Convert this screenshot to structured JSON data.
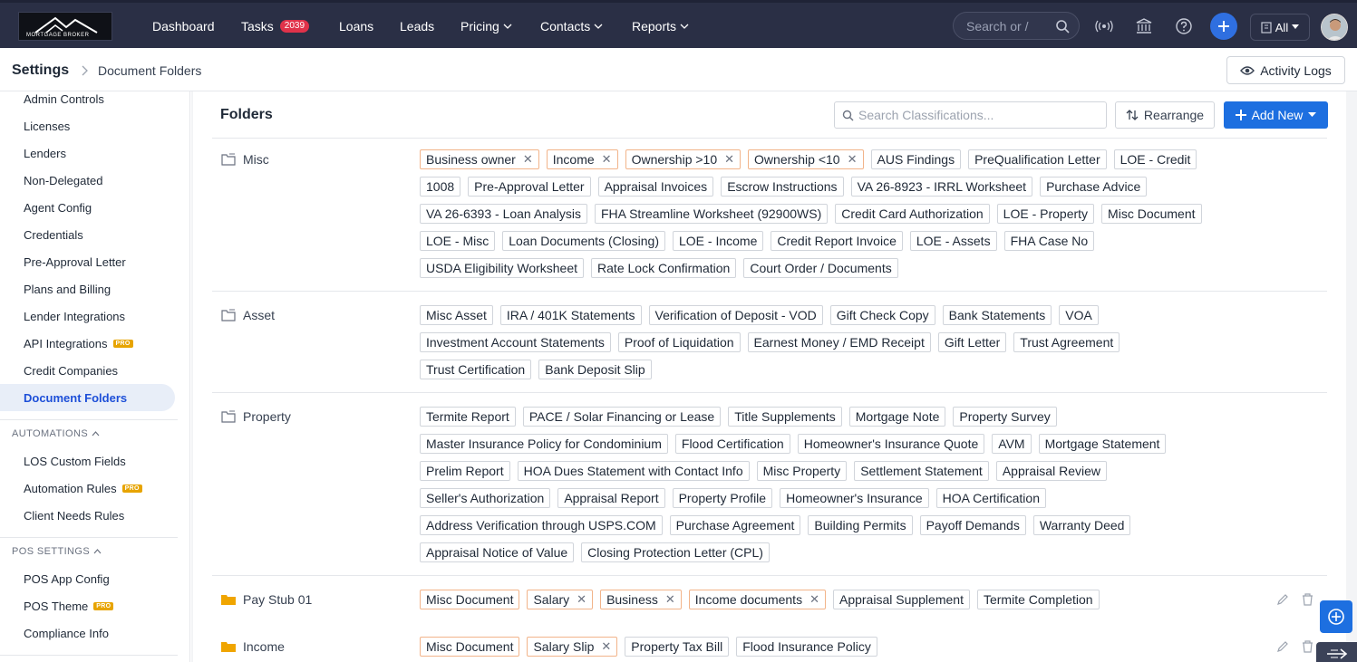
{
  "nav": {
    "logo_text": "MORTGAGE BROKER",
    "items": [
      "Dashboard",
      "Tasks",
      "Loans",
      "Leads",
      "Pricing",
      "Contacts",
      "Reports"
    ],
    "tasks_badge": "2039",
    "search_placeholder": "Search or /",
    "scope_select": "All"
  },
  "subheader": {
    "title": "Settings",
    "crumb": "Document Folders",
    "activity_logs": "Activity Logs"
  },
  "sidebar": {
    "items_top": [
      "Admin Controls",
      "Licenses",
      "Lenders",
      "Non-Delegated",
      "Agent Config",
      "Credentials",
      "Pre-Approval Letter",
      "Plans and Billing",
      "Lender Integrations",
      "API Integrations",
      "Credit Companies",
      "Document Folders"
    ],
    "automations_label": "AUTOMATIONS",
    "automations_items": [
      "LOS Custom Fields",
      "Automation Rules",
      "Client Needs Rules"
    ],
    "pos_label": "POS SETTINGS",
    "pos_items": [
      "POS App Config",
      "POS Theme",
      "Compliance Info"
    ],
    "pro_label": "PRO"
  },
  "main": {
    "title": "Folders",
    "search_placeholder": "Search Classifications...",
    "rearrange": "Rearrange",
    "add_new": "Add New",
    "folders": [
      {
        "name": "Misc",
        "custom": false,
        "tags": [
          {
            "label": "Business owner",
            "removable": true
          },
          {
            "label": "Income",
            "removable": true
          },
          {
            "label": "Ownership >10",
            "removable": true
          },
          {
            "label": "Ownership <10",
            "removable": true
          },
          {
            "label": "AUS Findings"
          },
          {
            "label": "PreQualification Letter"
          },
          {
            "label": "LOE - Credit"
          },
          {
            "label": "1008"
          },
          {
            "label": "Pre-Approval Letter"
          },
          {
            "label": "Appraisal Invoices"
          },
          {
            "label": "Escrow Instructions"
          },
          {
            "label": "VA 26-8923 - IRRL Worksheet"
          },
          {
            "label": "Purchase Advice"
          },
          {
            "label": "VA 26-6393 - Loan Analysis"
          },
          {
            "label": "FHA Streamline Worksheet (92900WS)"
          },
          {
            "label": "Credit Card Authorization"
          },
          {
            "label": "LOE - Property"
          },
          {
            "label": "Misc Document"
          },
          {
            "label": "LOE - Misc"
          },
          {
            "label": "Loan Documents (Closing)"
          },
          {
            "label": "LOE - Income"
          },
          {
            "label": "Credit Report Invoice"
          },
          {
            "label": "LOE - Assets"
          },
          {
            "label": "FHA Case No"
          },
          {
            "label": "USDA Eligibility Worksheet"
          },
          {
            "label": "Rate Lock Confirmation"
          },
          {
            "label": "Court Order / Documents"
          }
        ]
      },
      {
        "name": "Asset",
        "custom": false,
        "tags": [
          {
            "label": "Misc Asset"
          },
          {
            "label": "IRA / 401K Statements"
          },
          {
            "label": "Verification of Deposit - VOD"
          },
          {
            "label": "Gift Check Copy"
          },
          {
            "label": "Bank Statements"
          },
          {
            "label": "VOA"
          },
          {
            "label": "Investment Account Statements"
          },
          {
            "label": "Proof of Liquidation"
          },
          {
            "label": "Earnest Money / EMD Receipt"
          },
          {
            "label": "Gift Letter"
          },
          {
            "label": "Trust Agreement"
          },
          {
            "label": "Trust Certification"
          },
          {
            "label": "Bank Deposit Slip"
          }
        ]
      },
      {
        "name": "Property",
        "custom": false,
        "tags": [
          {
            "label": "Termite Report"
          },
          {
            "label": "PACE / Solar Financing or Lease"
          },
          {
            "label": "Title Supplements"
          },
          {
            "label": "Mortgage Note"
          },
          {
            "label": "Property Survey"
          },
          {
            "label": "Master Insurance Policy for Condominium"
          },
          {
            "label": "Flood Certification"
          },
          {
            "label": "Homeowner's Insurance Quote"
          },
          {
            "label": "AVM"
          },
          {
            "label": "Mortgage Statement"
          },
          {
            "label": "Prelim Report"
          },
          {
            "label": "HOA Dues Statement with Contact Info"
          },
          {
            "label": "Misc Property"
          },
          {
            "label": "Settlement Statement"
          },
          {
            "label": "Appraisal Review"
          },
          {
            "label": "Seller's Authorization"
          },
          {
            "label": "Appraisal Report"
          },
          {
            "label": "Property Profile"
          },
          {
            "label": "Homeowner's Insurance"
          },
          {
            "label": "HOA Certification"
          },
          {
            "label": "Address Verification through USPS.COM"
          },
          {
            "label": "Purchase Agreement"
          },
          {
            "label": "Building Permits"
          },
          {
            "label": "Payoff Demands"
          },
          {
            "label": "Warranty Deed"
          },
          {
            "label": "Appraisal Notice of Value"
          },
          {
            "label": "Closing Protection Letter (CPL)"
          }
        ]
      },
      {
        "name": "Pay Stub 01",
        "custom": true,
        "tags": [
          {
            "label": "Misc Document",
            "highlight": true
          },
          {
            "label": "Salary",
            "removable": true
          },
          {
            "label": "Business",
            "removable": true
          },
          {
            "label": "Income documents",
            "removable": true
          },
          {
            "label": "Appraisal Supplement"
          },
          {
            "label": "Termite Completion"
          }
        ]
      },
      {
        "name": "Income",
        "custom": true,
        "tags": [
          {
            "label": "Misc Document",
            "highlight": true
          },
          {
            "label": "Salary Slip",
            "removable": true
          },
          {
            "label": "Property Tax Bill"
          },
          {
            "label": "Flood Insurance Policy"
          }
        ]
      }
    ]
  },
  "colors": {
    "nav_bg": "#2a2f45",
    "accent": "#1d6fe0",
    "active_bg": "#e8eef8",
    "custom_tag_border": "#f2b48a",
    "pro_badge": "#e7a400",
    "custom_folder_icon": "#f0a500"
  }
}
